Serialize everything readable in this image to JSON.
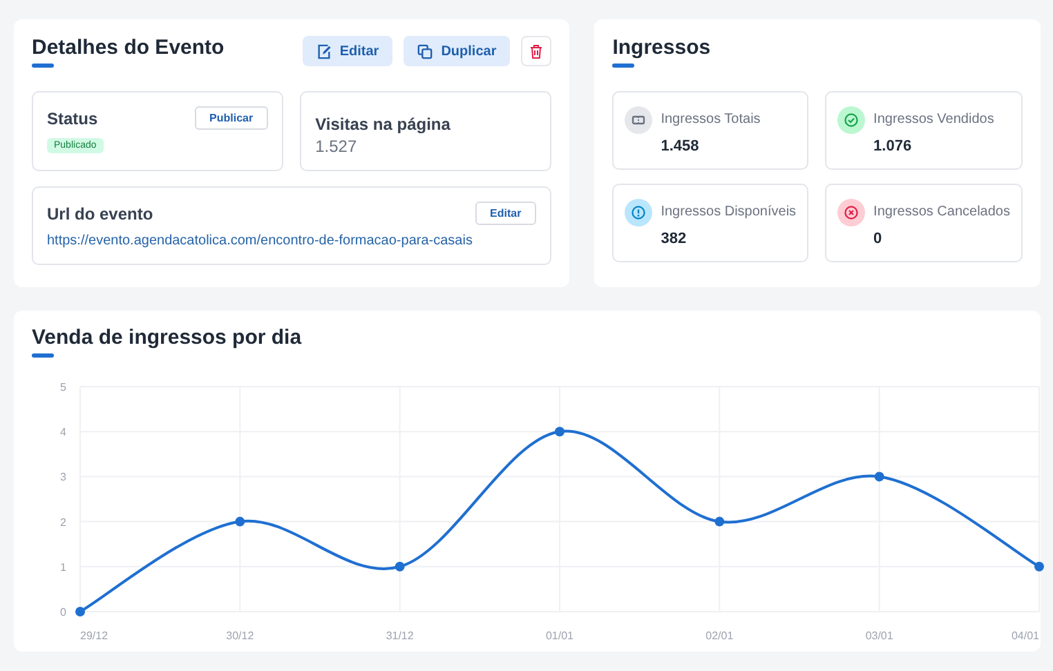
{
  "details": {
    "title": "Detalhes do Evento",
    "actions": [
      {
        "kind": "edit",
        "label": "Editar"
      },
      {
        "kind": "duplicate",
        "label": "Duplicar"
      },
      {
        "kind": "delete"
      }
    ],
    "status": {
      "label": "Status",
      "button": "Publicar",
      "badge": "Publicado"
    },
    "visits": {
      "label": "Visitas na página",
      "value": "1.527"
    },
    "url": {
      "label": "Url do evento",
      "button": "Editar",
      "link": "https://evento.agendacatolica.com/encontro-de-formacao-para-casais"
    }
  },
  "tickets": {
    "title": "Ingressos",
    "stats": [
      {
        "kind": "total",
        "label": "Ingressos Totais",
        "value": "1.458"
      },
      {
        "kind": "sold",
        "label": "Ingressos Vendidos",
        "value": "1.076"
      },
      {
        "kind": "available",
        "label": "Ingressos Disponíveis",
        "value": "382"
      },
      {
        "kind": "cancelled",
        "label": "Ingressos Cancelados",
        "value": "0"
      }
    ]
  },
  "sales": {
    "title": "Venda de ingressos por dia",
    "chart_data": {
      "type": "line",
      "categories": [
        "29/12",
        "30/12",
        "31/12",
        "01/01",
        "02/01",
        "03/01",
        "04/01"
      ],
      "series": [
        {
          "color": "#1f6fd1",
          "marker": true,
          "values": [
            0,
            2,
            1,
            4,
            2,
            3,
            1
          ]
        }
      ],
      "grid": true,
      "ylim": [
        0,
        5
      ],
      "yticks": [
        0,
        1,
        2,
        3,
        4,
        5
      ]
    }
  }
}
